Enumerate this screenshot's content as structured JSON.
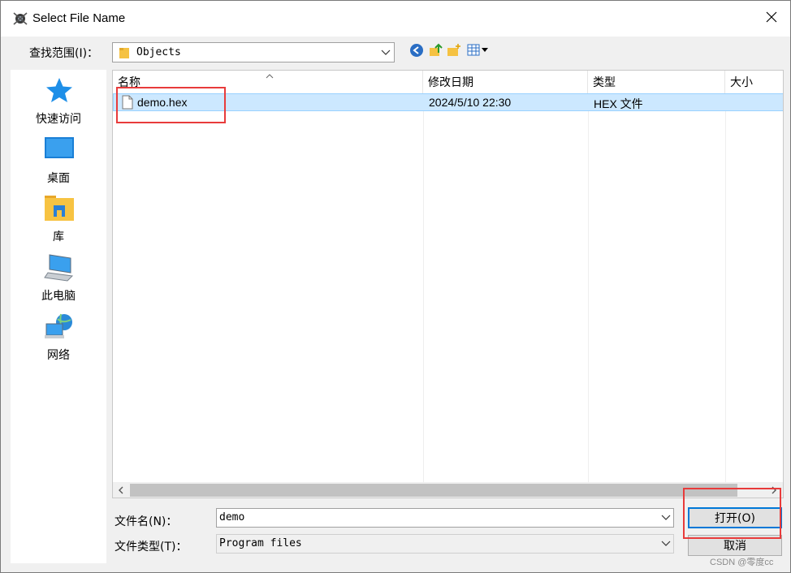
{
  "window": {
    "title": "Select File Name",
    "icons": {
      "app": "app-logo-icon",
      "close": "close-icon"
    }
  },
  "lookin": {
    "label": "查找范围(I)：",
    "value": "Objects",
    "toolbar": [
      "back-icon",
      "up-folder-icon",
      "new-folder-icon",
      "view-menu-icon"
    ]
  },
  "places": [
    {
      "label": "快速访问",
      "icon": "star-icon"
    },
    {
      "label": "桌面",
      "icon": "desktop-icon"
    },
    {
      "label": "库",
      "icon": "library-icon"
    },
    {
      "label": "此电脑",
      "icon": "computer-icon"
    },
    {
      "label": "网络",
      "icon": "network-icon"
    }
  ],
  "file_list": {
    "columns": [
      "名称",
      "修改日期",
      "类型",
      "大小"
    ],
    "rows": [
      {
        "name": "demo.hex",
        "modified": "2024/5/10 22:30",
        "type": "HEX 文件",
        "size": ""
      }
    ]
  },
  "filename": {
    "label": "文件名(N)：",
    "value": "demo"
  },
  "filetype": {
    "label": "文件类型(T)：",
    "value": "Program files"
  },
  "buttons": {
    "open": "打开(O)",
    "cancel": "取消"
  },
  "watermark": "CSDN @零度cc",
  "colors": {
    "selection": "#cce8ff",
    "highlight_box": "#e83b3b",
    "accent": "#0078d7"
  }
}
